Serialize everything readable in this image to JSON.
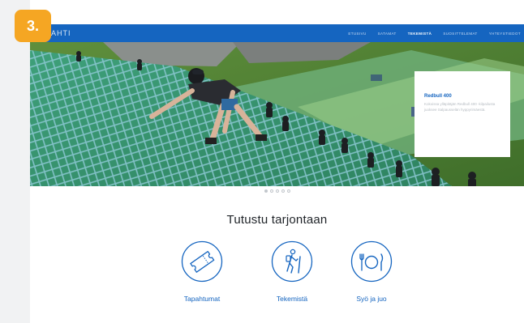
{
  "step_badge": "3.",
  "brand": {
    "logo_text": "LAHTI"
  },
  "nav": {
    "items": [
      {
        "label": "ETUSIVU",
        "active": false
      },
      {
        "label": "SATAMAT",
        "active": false
      },
      {
        "label": "TEKEMISTÄ",
        "active": true
      },
      {
        "label": "SUOSITTELEMAT",
        "active": false
      },
      {
        "label": "YHTEYSTIEDOT",
        "active": false
      }
    ]
  },
  "hero": {
    "card_title": "Redbull 400",
    "card_text": "Kokoissa ylläpitäjän Redbull 400 -kilpailusta juoksee Salpausselän hyppyrimäestä."
  },
  "carousel": {
    "count": 5,
    "active_index": 0
  },
  "section": {
    "title": "Tutustu tarjontaan"
  },
  "categories": [
    {
      "label": "Tapahtumat",
      "icon": "ticket-icon"
    },
    {
      "label": "Tekemistä",
      "icon": "hiker-icon"
    },
    {
      "label": "Syö ja juo",
      "icon": "dining-icon"
    }
  ],
  "colors": {
    "accent": "#1565c0",
    "badge": "#f5a623"
  }
}
